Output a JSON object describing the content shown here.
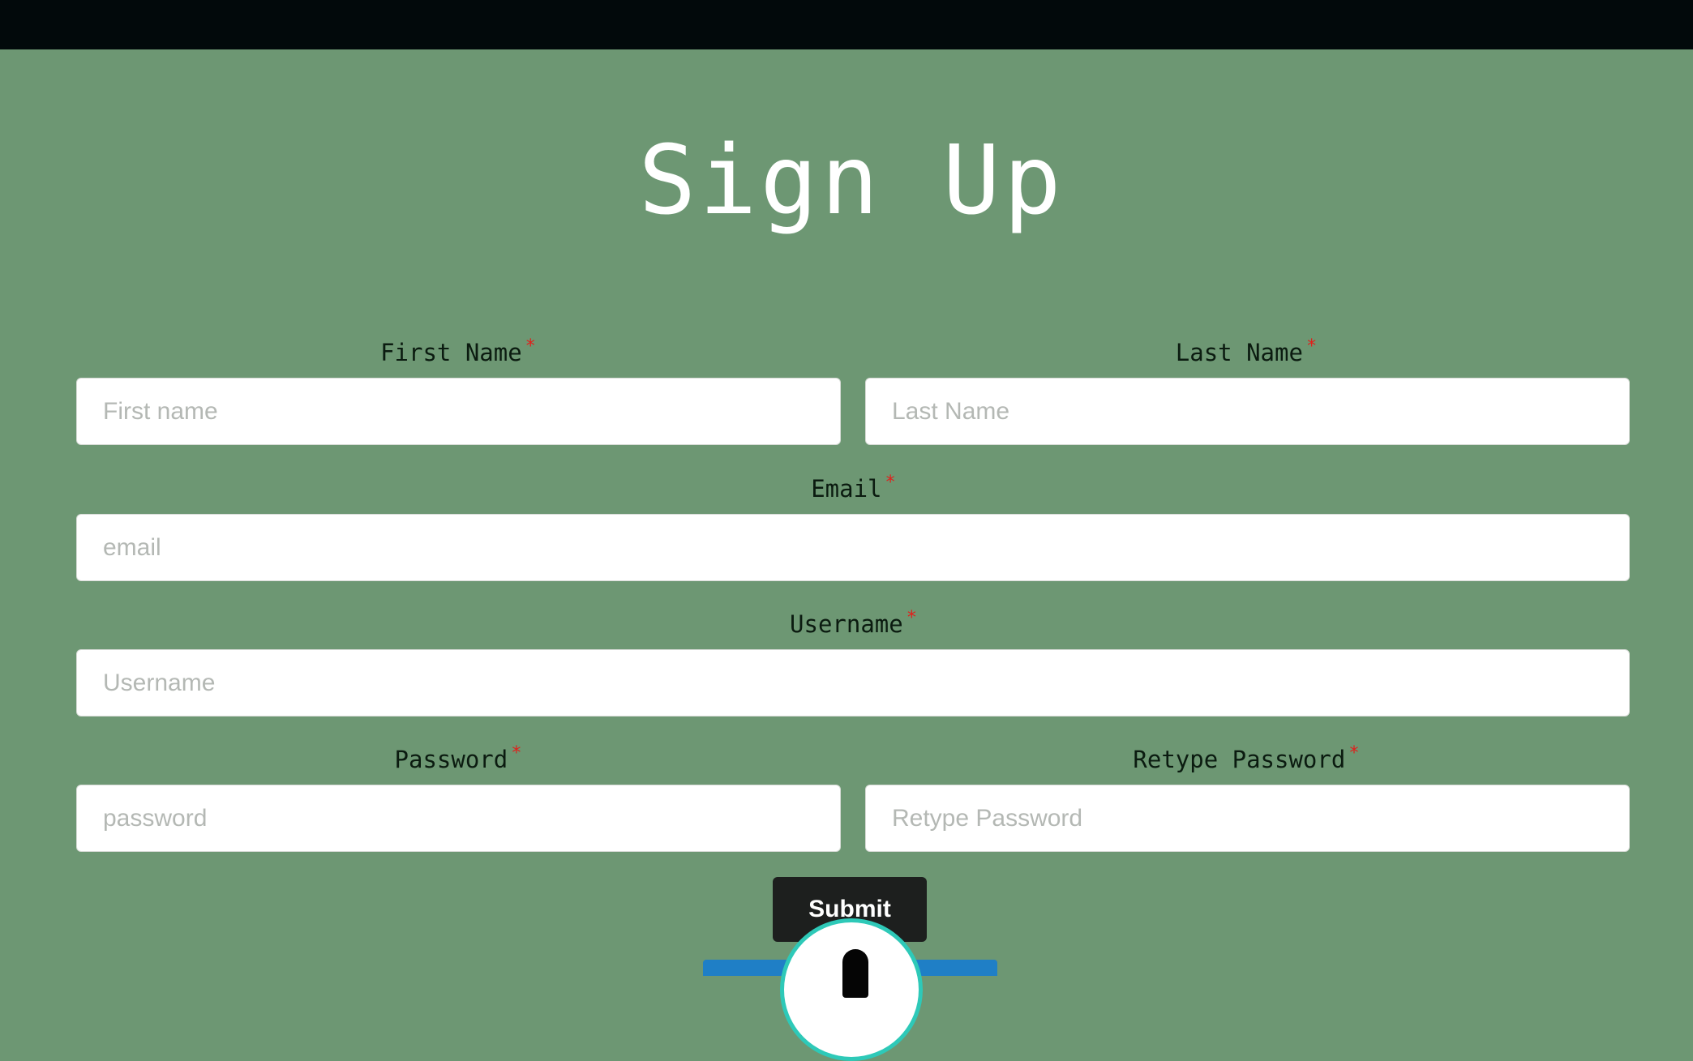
{
  "form": {
    "title": "Sign Up",
    "required_marker": "*",
    "first_name": {
      "label": "First Name",
      "placeholder": "First name",
      "value": ""
    },
    "last_name": {
      "label": "Last Name",
      "placeholder": "Last Name",
      "value": ""
    },
    "email": {
      "label": "Email",
      "placeholder": "email",
      "value": ""
    },
    "username": {
      "label": "Username",
      "placeholder": "Username",
      "value": ""
    },
    "password": {
      "label": "Password",
      "placeholder": "password",
      "value": ""
    },
    "retype_password": {
      "label": "Retype Password",
      "placeholder": "Retype Password",
      "value": ""
    },
    "submit_label": "Submit"
  },
  "colors": {
    "background": "#6d9773",
    "topbar": "#02090b",
    "required": "#e0201c",
    "button": "#1d1f1e",
    "bubble_border": "#2ec9b8",
    "bar": "#1f7fc6"
  },
  "overlay": {
    "icon": "alert-avatar-icon"
  }
}
